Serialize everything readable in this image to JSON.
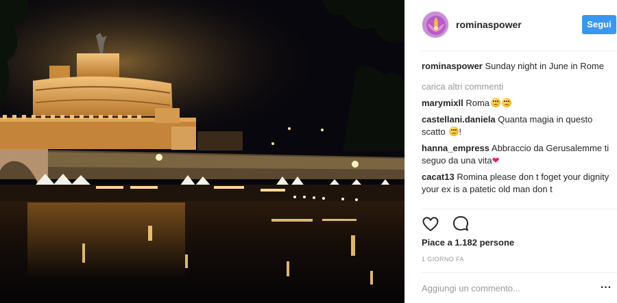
{
  "post": {
    "photo_icon": "castel-sant-angelo-night-photo",
    "header": {
      "username": "rominaspower",
      "avatar_icon": "avatar-image",
      "follow_label": "Segui"
    },
    "caption": {
      "username": "rominaspower",
      "text": "Sunday night in June in Rome"
    },
    "load_more_label": "carica altri commenti",
    "comments": [
      {
        "username": "marymixll",
        "text": "Roma",
        "emojis": [
          "weary-face-icon",
          "weary-face-icon"
        ]
      },
      {
        "username": "castellani.daniela",
        "text": "Quanta magia in questo scatto",
        "suffix": "!",
        "emojis": [
          "kissing-face-icon"
        ]
      },
      {
        "username": "hanna_empress",
        "text": "Abbraccio da Gerusalemme ti seguo da una vita",
        "emojis": [
          "red-heart-icon"
        ]
      },
      {
        "username": "cacat13",
        "text": "Romina please don t foget your dignity your ex is a patetic old man don t"
      }
    ],
    "actions": {
      "like_icon": "heart-icon",
      "comment_icon": "comment-bubble-icon"
    },
    "likes_text": "Piace a 1.182 persone",
    "timestamp": "1 GIORNO FA",
    "add_comment_placeholder": "Aggiungi un commento...",
    "more_label": "...",
    "colors": {
      "accent": "#3897f0",
      "text": "#262626",
      "muted": "#999999",
      "divider": "#efefef"
    }
  }
}
